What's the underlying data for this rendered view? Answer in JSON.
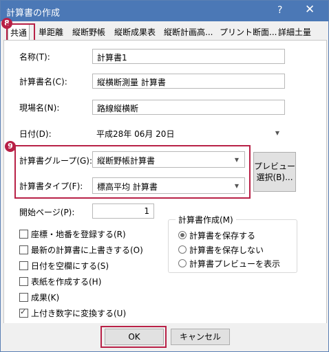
{
  "window": {
    "title": "計算書の作成",
    "help_glyph": "?",
    "close_glyph": "✕"
  },
  "tabs": [
    {
      "label": "共通",
      "active": true
    },
    {
      "label": "単距離"
    },
    {
      "label": "縦断野帳"
    },
    {
      "label": "縦断成果表"
    },
    {
      "label": "縦断計画高..."
    },
    {
      "label": "プリント断面..."
    },
    {
      "label": "詳細土量"
    }
  ],
  "callouts": {
    "tab": "8",
    "group": "9"
  },
  "fields": {
    "name": {
      "label": "名称(T):",
      "value": "計算書1"
    },
    "doc_name": {
      "label": "計算書名(C):",
      "value": "縦横断測量 計算書"
    },
    "site_name": {
      "label": "現場名(N):",
      "value": "路線縦横断"
    },
    "date": {
      "label": "日付(D):",
      "value": "平成28年 06月 20日"
    },
    "group": {
      "label": "計算書グループ(G):",
      "value": "縦断野帳計算書"
    },
    "type": {
      "label": "計算書タイプ(F):",
      "value": "標高平均 計算書"
    },
    "start_page": {
      "label": "開始ページ(P):",
      "value": "1"
    }
  },
  "preview_button": {
    "line1": "プレビュー",
    "line2": "選択(B)..."
  },
  "checkboxes": [
    {
      "label": "座標・地番を登録する(R)",
      "checked": false
    },
    {
      "label": "最新の計算書に上書きする(O)",
      "checked": false
    },
    {
      "label": "日付を空欄にする(S)",
      "checked": false
    },
    {
      "label": "表紙を作成する(H)",
      "checked": false
    },
    {
      "label": "成果(K)",
      "checked": false
    },
    {
      "label": "上付き数字に変換する(U)",
      "checked": true
    }
  ],
  "create_group": {
    "legend": "計算書作成(M)",
    "options": [
      {
        "label": "計算書を保存する",
        "selected": true
      },
      {
        "label": "計算書を保存しない",
        "selected": false
      },
      {
        "label": "計算書プレビューを表示",
        "selected": false
      }
    ]
  },
  "footer": {
    "ok": "OK",
    "cancel": "キャンセル"
  },
  "colors": {
    "highlight": "#b82046",
    "titlebar": "#4b78b6"
  }
}
